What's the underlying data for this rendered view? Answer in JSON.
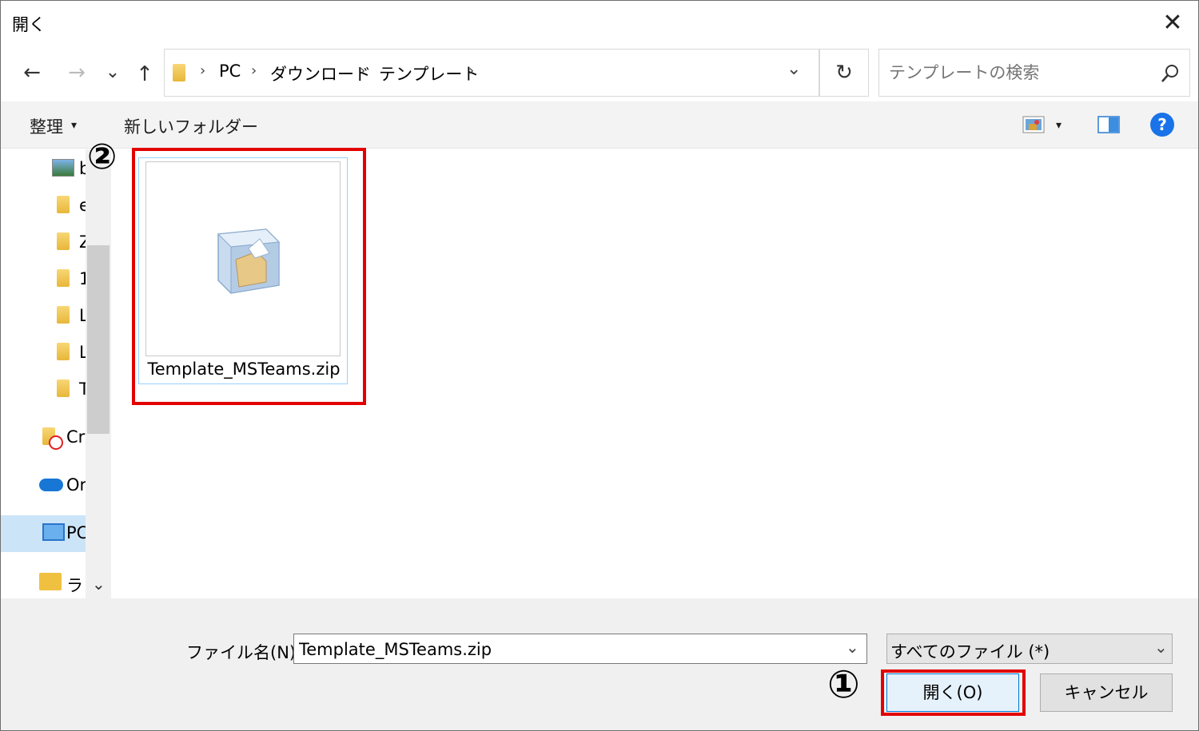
{
  "window": {
    "title": "開く",
    "close_glyph": "✕"
  },
  "nav": {
    "back": "←",
    "forward": "→",
    "recent": "⌄",
    "up": "↑"
  },
  "breadcrumb": {
    "items": [
      "PC",
      "ダウンロード",
      "テンプレート"
    ],
    "separator": "›"
  },
  "refresh": "↻",
  "search": {
    "placeholder": "テンプレートの検索"
  },
  "toolbar": {
    "organize": "整理",
    "organize_caret": "▾",
    "new_folder": "新しいフォルダー",
    "view_caret": "▾",
    "help": "?"
  },
  "sidebar": {
    "items": [
      {
        "label": "b",
        "icon": "image-folder-icon"
      },
      {
        "label": "e",
        "icon": "folder-icon"
      },
      {
        "label": "Z",
        "icon": "folder-icon"
      },
      {
        "label": "1",
        "icon": "folder-icon"
      },
      {
        "label": "L",
        "icon": "folder-icon"
      },
      {
        "label": "L",
        "icon": "folder-icon"
      },
      {
        "label": "T",
        "icon": "folder-icon"
      },
      {
        "label": "Cr",
        "icon": "creative-cloud-folder-icon"
      },
      {
        "label": "Or",
        "icon": "onedrive-icon"
      },
      {
        "label": "PC",
        "icon": "pc-icon"
      },
      {
        "label": "ラ",
        "icon": "library-icon"
      }
    ],
    "expand": "⌄"
  },
  "files": [
    {
      "name": "Template_MSTeams.zip",
      "icon": "zip-archive-icon"
    }
  ],
  "annotations": {
    "step1": "①",
    "step2": "②"
  },
  "footer": {
    "filename_label": "ファイル名(N):",
    "filename_value": "Template_MSTeams.zip",
    "filetype": "すべてのファイル (*)",
    "open_button": "開く(O)",
    "cancel_button": "キャンセル"
  },
  "colors": {
    "highlight_red": "#e20000",
    "help_blue": "#1a73e8",
    "selection_border": "#99d1ff"
  }
}
